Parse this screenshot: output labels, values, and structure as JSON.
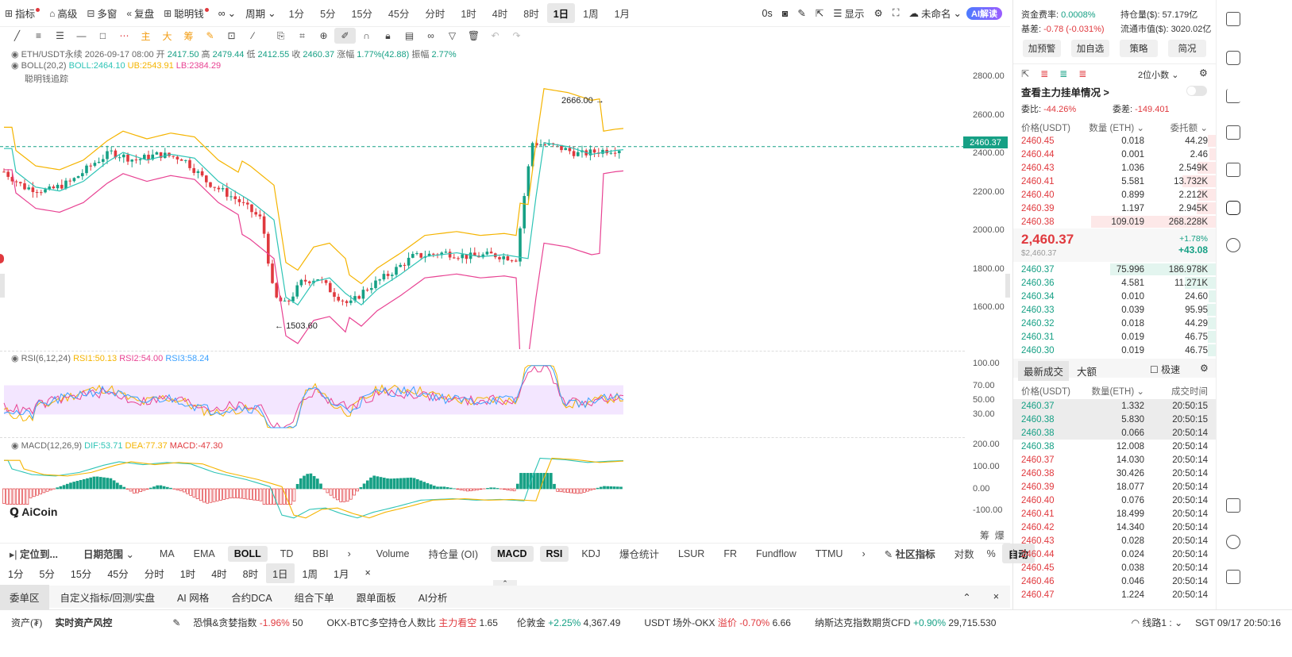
{
  "toolbar": {
    "indicator": "指标",
    "advanced": "高级",
    "multi_window": "多窗",
    "replay": "复盘",
    "smart_money": "聪明钱",
    "period": "周期",
    "timeframes": [
      "1分",
      "5分",
      "15分",
      "45分",
      "分时",
      "1时",
      "4时",
      "8时",
      "1日",
      "1周",
      "1月"
    ],
    "active_tf": "1日",
    "countdown": "0s",
    "display": "显示",
    "unnamed": "未命名",
    "ai_read": "AI解读"
  },
  "drawing_tools": {
    "main": "主",
    "big": "大",
    "chip": "筹"
  },
  "legend": {
    "symbol": "ETH/USDT永续",
    "date": "2026-09-17 08:00",
    "open_label": "开",
    "open": "2417.50",
    "high_label": "高",
    "high": "2479.44",
    "low_label": "低",
    "low": "2412.55",
    "close_label": "收",
    "close": "2460.37",
    "change_label": "涨幅",
    "change": "1.77%(42.88)",
    "amp_label": "振幅",
    "amp": "2.77%",
    "boll_label": "BOLL(20,2)",
    "boll": "BOLL:2464.10",
    "ub": "UB:2543.91",
    "lb": "LB:2384.29",
    "smart_trace": "聪明钱追踪",
    "rsi_label": "RSI(6,12,24)",
    "rsi1": "RSI1:50.13",
    "rsi2": "RSI2:54.00",
    "rsi3": "RSI3:58.24",
    "macd_label": "MACD(12,26,9)",
    "dif": "DIF:53.71",
    "dea": "DEA:77.37",
    "macd": "MACD:-47.30"
  },
  "main_axis": [
    "2800.00",
    "2600.00",
    "2400.00",
    "2200.00",
    "2000.00",
    "1800.00",
    "1600.00"
  ],
  "last_price_tag": "2460.37",
  "high_mark": "2666.00",
  "low_mark": "1503.60",
  "rsi_axis": [
    "100.00",
    "70.00",
    "50.00",
    "30.00"
  ],
  "macd_axis": [
    "200.00",
    "100.00",
    "0.00",
    "-100.00"
  ],
  "watermark": "AiCoin",
  "chip_labels": {
    "chip": "筹",
    "burst": "爆"
  },
  "bottom_bar": {
    "locate": "定位到...",
    "date_range": "日期范围",
    "main_ind": [
      "MA",
      "EMA",
      "BOLL",
      "TD",
      "BBI"
    ],
    "sub_ind": [
      "Volume",
      "持仓量 (OI)",
      "MACD",
      "RSI",
      "KDJ",
      "爆仓统计",
      "LSUR",
      "FR",
      "Fundflow",
      "TTMU"
    ],
    "community": "社区指标",
    "log": "对数",
    "pct": "%",
    "auto": "自动"
  },
  "tf_bar": [
    "1分",
    "5分",
    "15分",
    "45分",
    "分时",
    "1时",
    "4时",
    "8时",
    "1日",
    "1周",
    "1月"
  ],
  "tabs": [
    "委单区",
    "自定义指标/回测/实盘",
    "AI 网格",
    "合约DCA",
    "组合下单",
    "跟单面板",
    "AI分析"
  ],
  "status": {
    "assets": "资产(₮)",
    "risk": "实时资产风控",
    "fear_label": "恐惧&贪婪指数",
    "fear_change": "-1.96%",
    "fear_val": "50",
    "ratio_label": "OKX-BTC多空持仓人数比",
    "ratio_tag": "主力看空",
    "ratio_val": "1.65",
    "gold_label": "伦敦金",
    "gold_change": "+2.25%",
    "gold_val": "4,367.49",
    "usdt_label": "USDT 场外-OKX",
    "usdt_tag": "溢价",
    "usdt_change": "-0.70%",
    "usdt_val": "6.66",
    "nasdaq_label": "纳斯达克指数期货CFD",
    "nasdaq_change": "+0.90%",
    "nasdaq_val": "29,715.530",
    "line": "线路1 :",
    "time": "SGT 09/17 20:50:16"
  },
  "right": {
    "funding_label": "资金费率:",
    "funding": "0.0008%",
    "oi_label": "持仓量($):",
    "oi": "57.179亿",
    "basis_label": "基差:",
    "basis": "-0.78 (-0.031%)",
    "mcap_label": "流通市值($):",
    "mcap": "3020.02亿",
    "buttons": [
      "加预警",
      "加自选",
      "策略",
      "简况"
    ],
    "decimals": "2位小数",
    "main_orders": "查看主力挂单情况 >",
    "ratio_label": "委比:",
    "ratio": "-44.26%",
    "diff_label": "委差:",
    "diff": "-149.401",
    "ob_headers": [
      "价格(USDT)",
      "数量 (ETH)",
      "委托额"
    ],
    "asks": [
      [
        "2460.45",
        "0.018",
        "44.29"
      ],
      [
        "2460.44",
        "0.001",
        "2.46"
      ],
      [
        "2460.43",
        "1.036",
        "2.549K"
      ],
      [
        "2460.41",
        "5.581",
        "13.732K"
      ],
      [
        "2460.40",
        "0.899",
        "2.212K"
      ],
      [
        "2460.39",
        "1.197",
        "2.945K"
      ],
      [
        "2460.38",
        "109.019",
        "268.228K"
      ]
    ],
    "last": "2,460.37",
    "last_usd": "$2,460.37",
    "pct": "+1.78%",
    "chg": "+43.08",
    "bids": [
      [
        "2460.37",
        "75.996",
        "186.978K"
      ],
      [
        "2460.36",
        "4.581",
        "11.271K"
      ],
      [
        "2460.34",
        "0.010",
        "24.60"
      ],
      [
        "2460.33",
        "0.039",
        "95.95"
      ],
      [
        "2460.32",
        "0.018",
        "44.29"
      ],
      [
        "2460.31",
        "0.019",
        "46.75"
      ],
      [
        "2460.30",
        "0.019",
        "46.75"
      ]
    ],
    "trade_tabs": [
      "最新成交",
      "大额"
    ],
    "fast": "极速",
    "trade_headers": [
      "价格(USDT)",
      "数量(ETH)",
      "成交时间"
    ],
    "trades": [
      [
        "2460.37",
        "1.332",
        "20:50:15",
        "g"
      ],
      [
        "2460.38",
        "5.830",
        "20:50:15",
        "g"
      ],
      [
        "2460.38",
        "0.066",
        "20:50:14",
        "g"
      ],
      [
        "2460.38",
        "12.008",
        "20:50:14",
        "g"
      ],
      [
        "2460.37",
        "14.030",
        "20:50:14",
        "r"
      ],
      [
        "2460.38",
        "30.426",
        "20:50:14",
        "r"
      ],
      [
        "2460.39",
        "18.077",
        "20:50:14",
        "r"
      ],
      [
        "2460.40",
        "0.076",
        "20:50:14",
        "r"
      ],
      [
        "2460.41",
        "18.499",
        "20:50:14",
        "r"
      ],
      [
        "2460.42",
        "14.340",
        "20:50:14",
        "r"
      ],
      [
        "2460.43",
        "0.028",
        "20:50:14",
        "r"
      ],
      [
        "2460.44",
        "0.024",
        "20:50:14",
        "r"
      ],
      [
        "2460.45",
        "0.038",
        "20:50:14",
        "r"
      ],
      [
        "2460.46",
        "0.046",
        "20:50:14",
        "r"
      ],
      [
        "2460.47",
        "1.224",
        "20:50:14",
        "r"
      ]
    ]
  },
  "colors": {
    "up": "#16a085",
    "down": "#e0393e",
    "boll_mid": "#2ec4b6",
    "boll_up": "#f5b400",
    "boll_low": "#e84393",
    "rsi1": "#f5b400",
    "rsi2": "#e84393",
    "rsi3": "#3aa0ff"
  }
}
